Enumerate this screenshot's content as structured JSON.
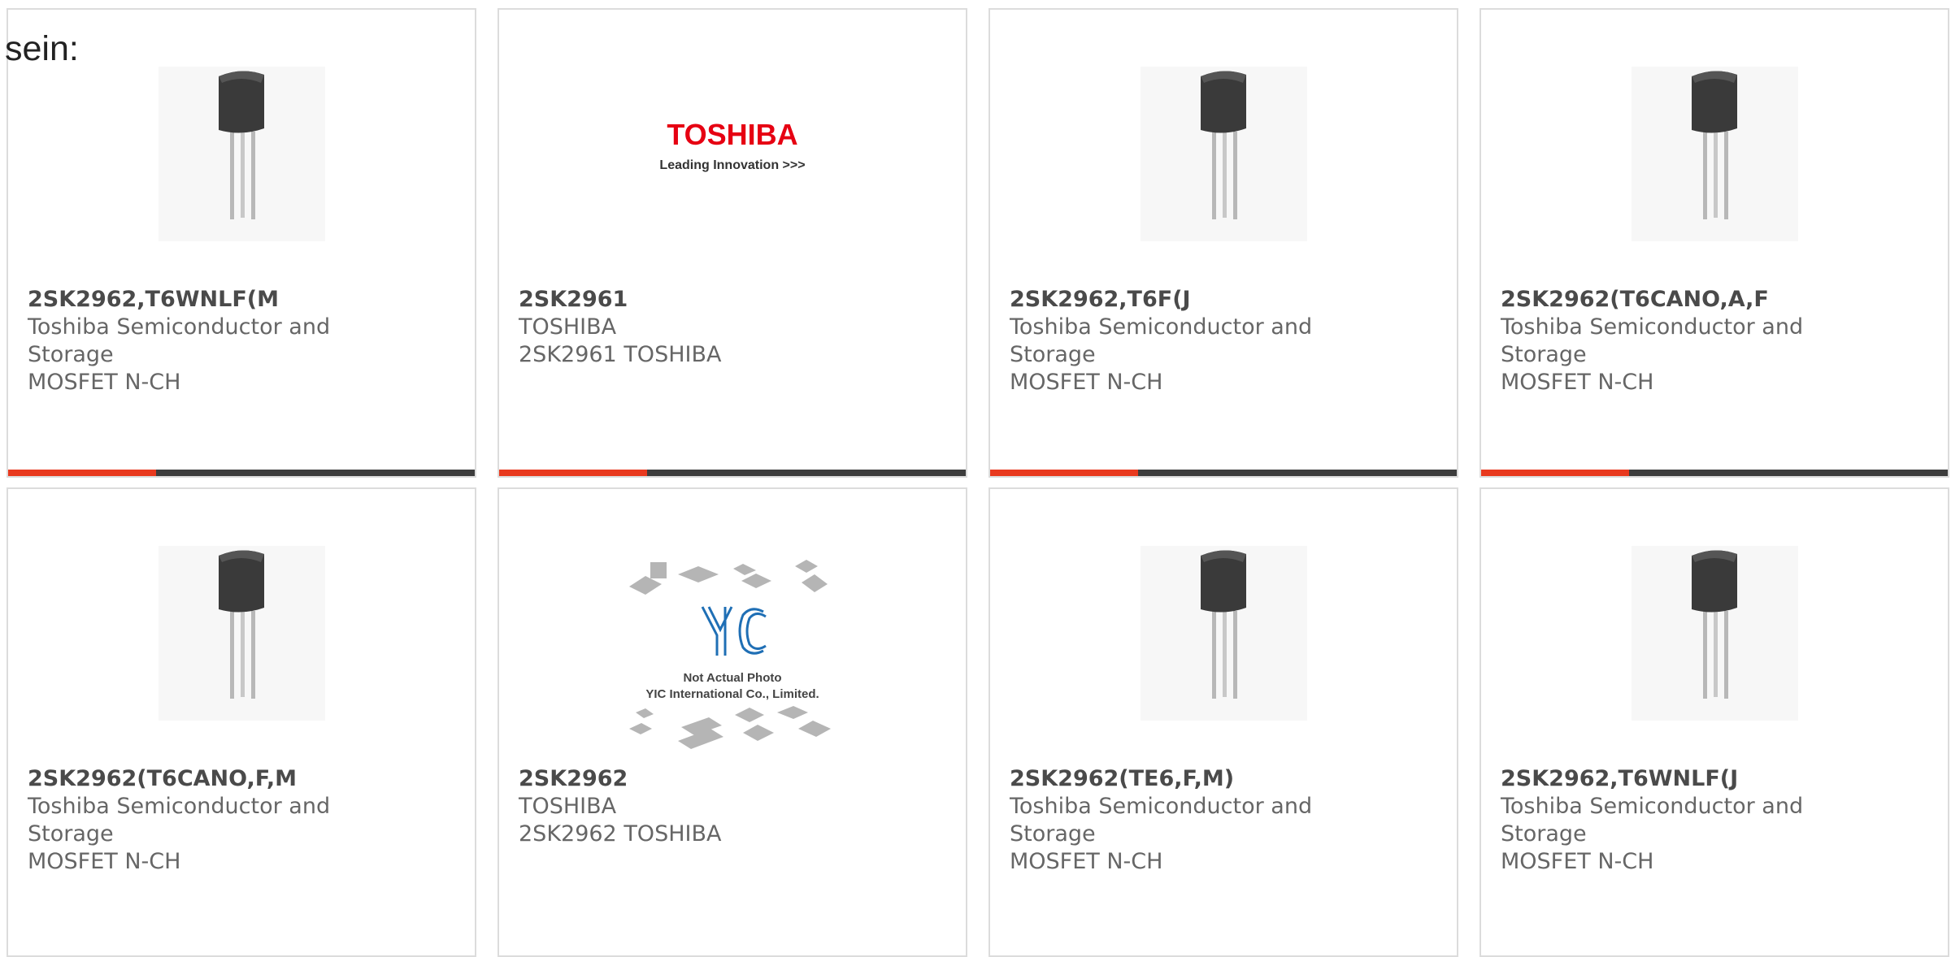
{
  "intro_text": "sein:",
  "colors": {
    "accent": "#e8391e",
    "bar": "#3d3d3d",
    "border": "#dcdcdc",
    "text": "#666666",
    "toshiba_red": "#e60012",
    "yic_blue": "#1f6fb5"
  },
  "products": [
    {
      "part_number": "2SK2962,T6WNLF(M",
      "manufacturer": "Toshiba Semiconductor and Storage",
      "description": "MOSFET N-CH",
      "image": "to92-transistor"
    },
    {
      "part_number": "2SK2961",
      "manufacturer": "TOSHIBA",
      "description": "2SK2961 TOSHIBA",
      "image": "toshiba-logo",
      "logo": {
        "brand": "TOSHIBA",
        "tagline": "Leading Innovation >>>"
      }
    },
    {
      "part_number": "2SK2962,T6F(J",
      "manufacturer": "Toshiba Semiconductor and Storage",
      "description": "MOSFET N-CH",
      "image": "to92-transistor"
    },
    {
      "part_number": "2SK2962(T6CANO,A,F",
      "manufacturer": "Toshiba Semiconductor and Storage",
      "description": "MOSFET N-CH",
      "image": "to92-transistor"
    },
    {
      "part_number": "2SK2962(T6CANO,F,M",
      "manufacturer": "Toshiba Semiconductor and Storage",
      "description": "MOSFET N-CH",
      "image": "to92-transistor"
    },
    {
      "part_number": "2SK2962",
      "manufacturer": "TOSHIBA",
      "description": "2SK2962 TOSHIBA",
      "image": "yic-placeholder",
      "placeholder": {
        "brand": "YIC",
        "line1": "Not Actual Photo",
        "line2": "YIC International Co., Limited."
      }
    },
    {
      "part_number": "2SK2962(TE6,F,M)",
      "manufacturer": "Toshiba Semiconductor and Storage",
      "description": "MOSFET N-CH",
      "image": "to92-transistor"
    },
    {
      "part_number": "2SK2962,T6WNLF(J",
      "manufacturer": "Toshiba Semiconductor and Storage",
      "description": "MOSFET N-CH",
      "image": "to92-transistor"
    }
  ]
}
